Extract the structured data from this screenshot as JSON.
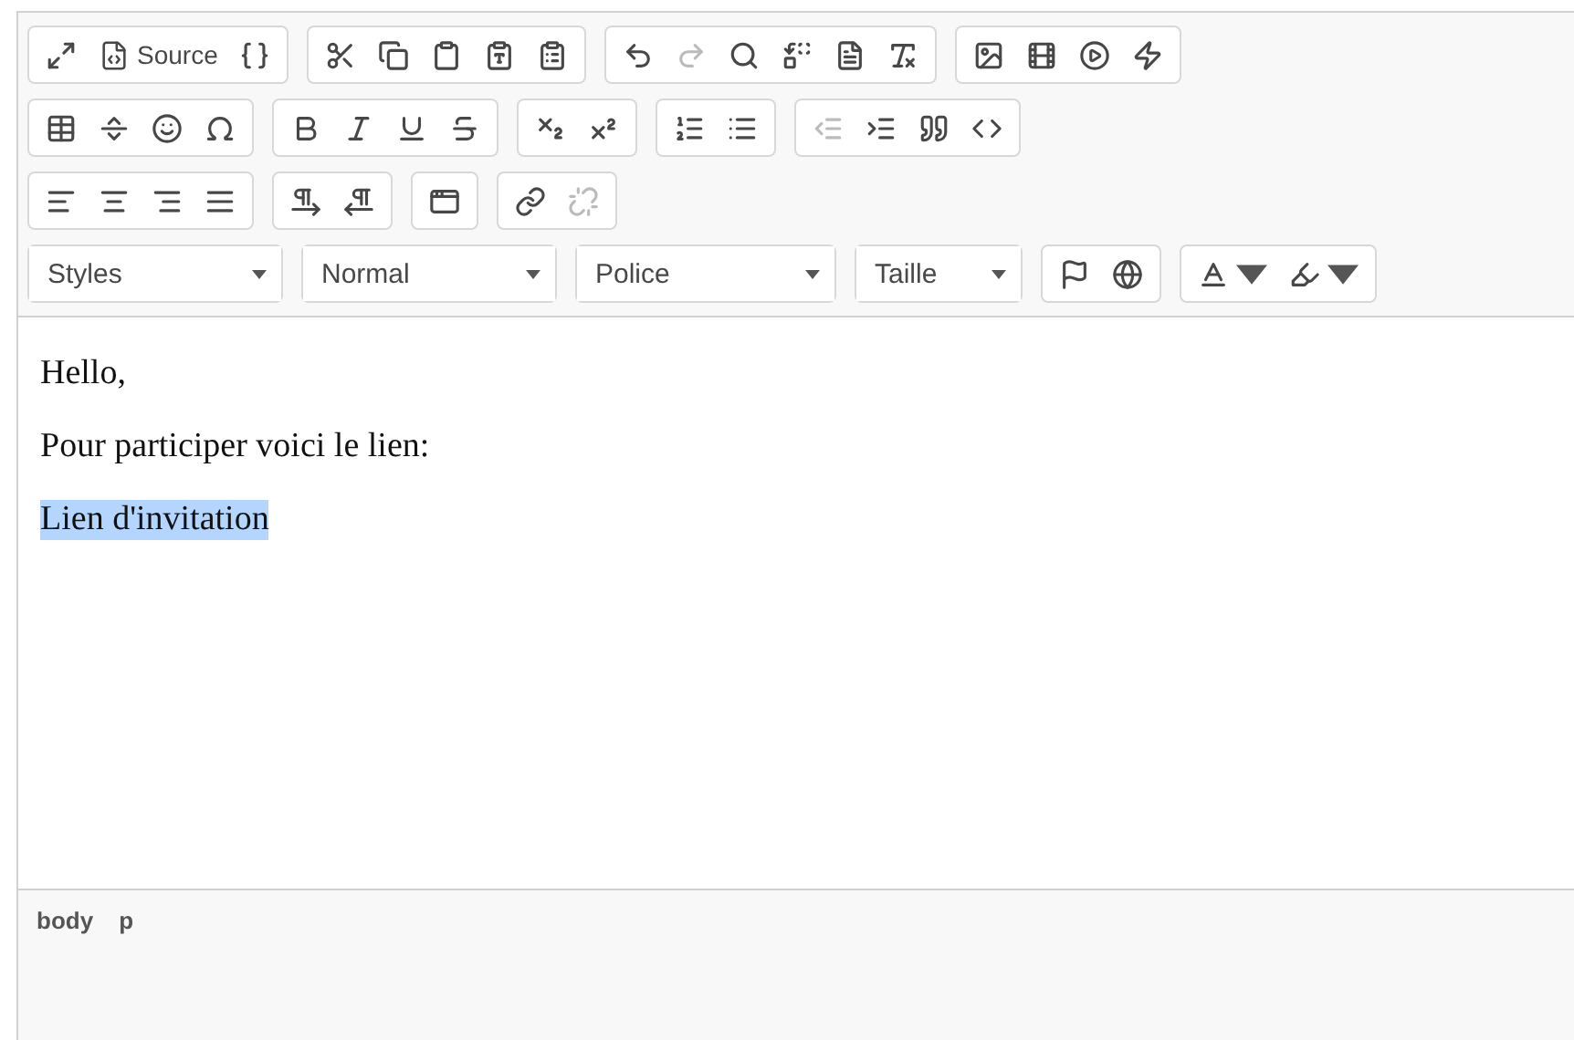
{
  "toolbar": {
    "rows": [
      [
        {
          "items": [
            {
              "kind": "icon",
              "disabled": false
            },
            {
              "kind": "text-button",
              "label": "Source",
              "disabled": false
            },
            {
              "kind": "icon",
              "disabled": false
            }
          ]
        },
        {
          "items": [
            {
              "kind": "icon",
              "disabled": false
            },
            {
              "kind": "icon",
              "disabled": false
            },
            {
              "kind": "icon",
              "disabled": false
            },
            {
              "kind": "icon",
              "disabled": false
            },
            {
              "kind": "icon",
              "disabled": false
            }
          ]
        },
        {
          "items": [
            {
              "kind": "icon",
              "disabled": false
            },
            {
              "kind": "icon",
              "disabled": true
            },
            {
              "kind": "icon",
              "disabled": false
            },
            {
              "kind": "icon",
              "disabled": false
            },
            {
              "kind": "icon",
              "disabled": false
            },
            {
              "kind": "icon",
              "disabled": false
            }
          ]
        },
        {
          "items": [
            {
              "kind": "icon",
              "disabled": false
            },
            {
              "kind": "icon",
              "disabled": false
            },
            {
              "kind": "icon",
              "disabled": false
            },
            {
              "kind": "icon",
              "disabled": false
            }
          ]
        }
      ],
      [
        {
          "items": [
            {
              "kind": "icon",
              "disabled": false
            },
            {
              "kind": "icon",
              "disabled": false
            },
            {
              "kind": "icon",
              "disabled": false
            },
            {
              "kind": "icon",
              "disabled": false
            }
          ]
        },
        {
          "items": [
            {
              "kind": "icon",
              "disabled": false
            },
            {
              "kind": "icon",
              "disabled": false
            },
            {
              "kind": "icon",
              "disabled": false
            },
            {
              "kind": "icon",
              "disabled": false
            }
          ]
        },
        {
          "items": [
            {
              "kind": "icon",
              "disabled": false
            },
            {
              "kind": "icon",
              "disabled": false
            }
          ]
        },
        {
          "items": [
            {
              "kind": "icon",
              "disabled": false
            },
            {
              "kind": "icon",
              "disabled": false
            }
          ]
        },
        {
          "items": [
            {
              "kind": "icon",
              "disabled": true
            },
            {
              "kind": "icon",
              "disabled": false
            },
            {
              "kind": "icon",
              "disabled": false
            },
            {
              "kind": "icon",
              "disabled": false
            }
          ]
        }
      ],
      [
        {
          "items": [
            {
              "kind": "icon",
              "disabled": false
            },
            {
              "kind": "icon",
              "disabled": false
            },
            {
              "kind": "icon",
              "disabled": false
            },
            {
              "kind": "icon",
              "disabled": false
            }
          ]
        },
        {
          "items": [
            {
              "kind": "icon",
              "disabled": false
            },
            {
              "kind": "icon",
              "disabled": false
            }
          ]
        },
        {
          "items": [
            {
              "kind": "icon",
              "disabled": false
            }
          ]
        },
        {
          "items": [
            {
              "kind": "icon",
              "disabled": false
            },
            {
              "kind": "icon",
              "disabled": true
            }
          ]
        }
      ],
      [
        {
          "items": [
            {
              "kind": "combo",
              "label": "Styles"
            }
          ]
        },
        {
          "items": [
            {
              "kind": "combo",
              "label": "Normal"
            }
          ]
        },
        {
          "items": [
            {
              "kind": "combo",
              "label": "Police"
            }
          ]
        },
        {
          "items": [
            {
              "kind": "combo",
              "label": "Taille"
            }
          ]
        },
        {
          "items": [
            {
              "kind": "icon",
              "disabled": false
            },
            {
              "kind": "icon",
              "disabled": false
            }
          ]
        },
        {
          "items": [
            {
              "kind": "color-menu",
              "disabled": false
            },
            {
              "kind": "color-menu",
              "disabled": false
            }
          ]
        }
      ]
    ]
  },
  "content": {
    "paragraphs": [
      {
        "text": "Hello,",
        "selected": false
      },
      {
        "text": "Pour participer voici le lien:",
        "selected": false
      },
      {
        "text": "Lien d'invitation",
        "selected": true
      }
    ]
  },
  "status_bar": {
    "path": [
      "body",
      "p"
    ]
  }
}
